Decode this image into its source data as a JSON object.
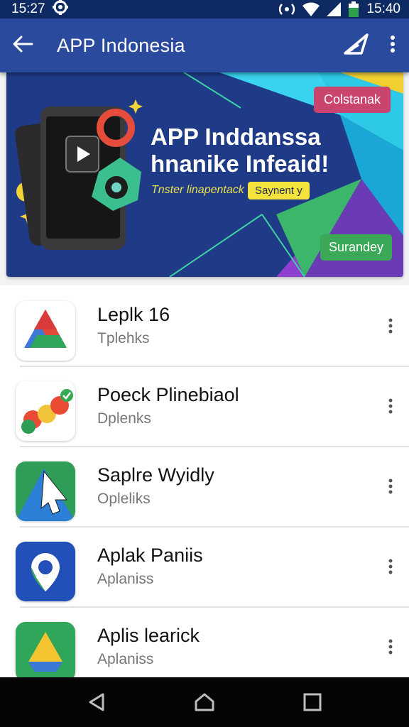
{
  "status_bar": {
    "time_left": "15:27",
    "time_right": "15:40",
    "icons": [
      "settings-notification-icon",
      "hotspot-icon",
      "wifi-icon",
      "signal-icon",
      "battery-icon"
    ]
  },
  "app_bar": {
    "title": "APP Indonesia",
    "icons": [
      "back-arrow-icon",
      "share-icon",
      "overflow-menu-icon"
    ]
  },
  "banner": {
    "top_pill": "Colstanak",
    "headline_line1": "APP Inddanssa",
    "headline_line2": "hnanike Infeaid!",
    "tagline": "Tnster linapentack",
    "badge": "Saynent y",
    "bottom_pill": "Surandey"
  },
  "apps": [
    {
      "name": "Leplk 16",
      "subtitle": "Tplehks",
      "icon": "drive-triangle-icon"
    },
    {
      "name": "Poeck Plinebiaol",
      "subtitle": "Dplenks",
      "icon": "colorful-logo-icon"
    },
    {
      "name": "Saplre Wyidly",
      "subtitle": "Opleliks",
      "icon": "cursor-arrow-icon"
    },
    {
      "name": "Aplak Paniis",
      "subtitle": "Aplaniss",
      "icon": "location-pin-icon"
    },
    {
      "name": "Aplis learick",
      "subtitle": "Aplaniss",
      "icon": "drive-triangle-icon"
    }
  ],
  "nav_bar": {
    "icons": [
      "back-nav-icon",
      "home-nav-icon",
      "recents-nav-icon"
    ]
  },
  "colors": {
    "status_bar": "#0e2a63",
    "app_bar": "#2a4a9e",
    "banner_bg": "#1f3a86",
    "pill_pink": "#c9456e",
    "pill_green": "#3aa857",
    "badge_yellow": "#f4e33a"
  }
}
